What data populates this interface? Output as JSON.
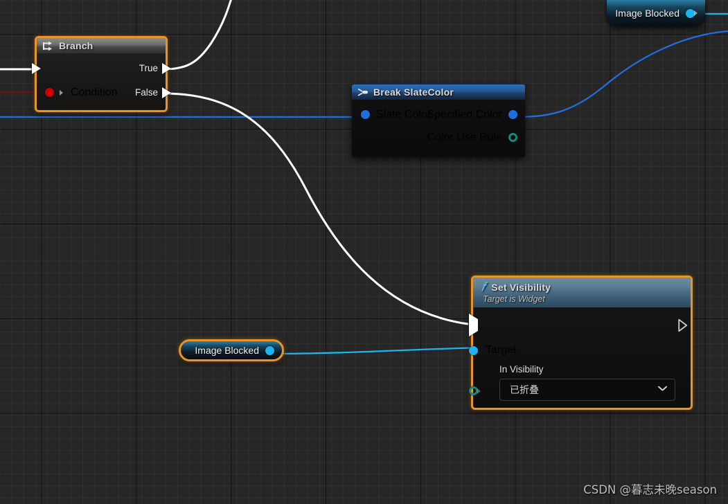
{
  "app": {
    "name": "Unreal Engine Blueprint Graph",
    "watermark": "CSDN @暮志未晚season"
  },
  "canvas": {
    "background_color": "#262626",
    "grid_minor_color": "rgba(255,255,255,0.042)",
    "grid_major_color": "rgba(0,0,0,0.55)",
    "grid_minor_spacing_px": 17,
    "grid_major_spacing_px": 137
  },
  "colors": {
    "selection_orange": "#e8942a",
    "exec_white": "#ffffff",
    "bool_red": "#cc0000",
    "linear_color_blue": "#1f6fe0",
    "object_cyan": "#1bb4f0",
    "enum_teal": "#14897c",
    "node_title_text": "#d8d8d8"
  },
  "nodes": {
    "branch": {
      "title": "Branch",
      "icon": "branch-icon",
      "selected": true,
      "inputs": [
        {
          "label": "",
          "pin": "exec-pin-icon",
          "type": "exec"
        },
        {
          "label": "Condition",
          "pin": "bool-pin-icon",
          "type": "bool"
        }
      ],
      "outputs": [
        {
          "label": "True",
          "pin": "exec-pin-icon",
          "type": "exec"
        },
        {
          "label": "False",
          "pin": "exec-pin-icon",
          "type": "exec"
        }
      ]
    },
    "break_slate_color": {
      "title": "Break SlateColor",
      "icon": "break-struct-icon",
      "selected": false,
      "inputs": [
        {
          "label": "Slate Color",
          "pin": "linear-color-pin-icon",
          "type": "struct"
        }
      ],
      "outputs": [
        {
          "label": "Specified Color",
          "pin": "linear-color-pin-icon",
          "type": "struct"
        },
        {
          "label": "Color Use Rule",
          "pin": "enum-pin-icon",
          "type": "enum"
        }
      ]
    },
    "set_visibility": {
      "title": "Set Visibility",
      "subtitle": "Target is Widget",
      "icon": "function-f-icon",
      "selected": true,
      "exec_in": "",
      "exec_out": "",
      "target_label": "Target",
      "in_visibility_label": "In Visibility",
      "in_visibility_value": "已折叠",
      "dropdown_icon": "chevron-down-icon"
    },
    "var_image_blocked_top": {
      "label": "Image Blocked",
      "selected": false,
      "pin": "object-pin-icon"
    },
    "var_image_blocked_bottom": {
      "label": "Image Blocked",
      "selected": true,
      "pin": "object-pin-icon"
    }
  },
  "wires": [
    {
      "name": "exec-into-branch",
      "type": "exec",
      "color": "#ffffff"
    },
    {
      "name": "bool-into-condition",
      "type": "bool",
      "color": "#6e1414"
    },
    {
      "name": "slatecolor-into-break",
      "type": "struct",
      "color": "#1f6fe0"
    },
    {
      "name": "branch-true-exec-up",
      "type": "exec",
      "color": "#ffffff"
    },
    {
      "name": "branch-false-to-setvisibility",
      "type": "exec",
      "color": "#ffffff"
    },
    {
      "name": "specified-color-out",
      "type": "struct",
      "color": "#1f6fe0"
    },
    {
      "name": "image-blocked-top-out",
      "type": "object",
      "color": "#1bb4f0"
    },
    {
      "name": "image-blocked-to-target",
      "type": "object",
      "color": "#1bb4f0"
    }
  ]
}
